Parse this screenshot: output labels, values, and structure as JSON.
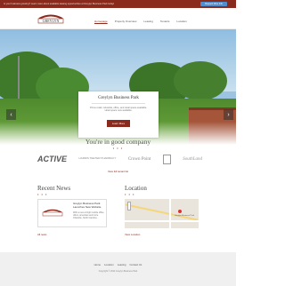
{
  "topbar": {
    "message": "Is your business growing? Learn more about available leasing opportunities at Greylyn Business Park today!",
    "button_label": "Request More Info"
  },
  "logo_text": "GREYLYN",
  "nav": [
    "Homepage",
    "Property Overview",
    "Leasing",
    "Tenants",
    "Location"
  ],
  "hero": {
    "title": "Greylyn Business Park",
    "description": "Prime retail, industrial, office, and retail space available. Hotel space now available.",
    "cta": "Learn More"
  },
  "company": {
    "heading": "You're in good company",
    "dots": "• • •",
    "logos": [
      "ACTIVE",
      "HARRIS TEETER PHARMACY",
      "Crown Point",
      "",
      "SouthLand"
    ],
    "view_all": "View full tenant list"
  },
  "news": {
    "heading": "Recent News",
    "dots": "• • •",
    "item_title": "Greylyn Business Park Launches New Website",
    "item_desc": "With a new a bright mobile office, offers, amenities and more. Charlotte, North Carolina...",
    "more": "All news"
  },
  "location": {
    "heading": "Location",
    "dots": "• • •",
    "map_label": "Greylyn Business Park",
    "more": "View Location"
  },
  "footer": {
    "links": [
      "Home",
      "Location",
      "Leasing",
      "Contact Us"
    ],
    "copyright": "Copyright © 2014 Greylyn Business Park"
  },
  "colors": {
    "accent": "#8a2a1c",
    "button_blue": "#4f8fd1"
  }
}
